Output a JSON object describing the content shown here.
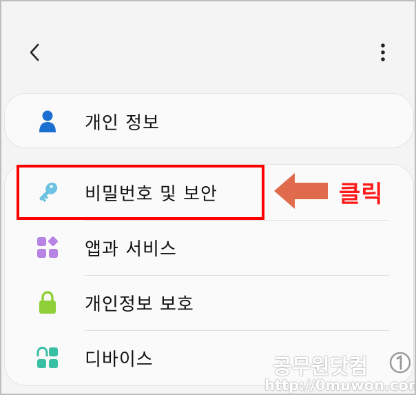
{
  "menu": {
    "items": [
      {
        "label": "개인 정보",
        "icon": "person-icon",
        "color": "#1a6fd1"
      },
      {
        "label": "비밀번호 및 보안",
        "icon": "key-icon",
        "color": "#6ec3e2"
      },
      {
        "label": "앱과 서비스",
        "icon": "apps-icon",
        "color": "#b784e6"
      },
      {
        "label": "개인정보 보호",
        "icon": "lock-icon",
        "color": "#8fcf38"
      },
      {
        "label": "디바이스",
        "icon": "devices-icon",
        "color": "#39bfa4"
      }
    ]
  },
  "annotation": {
    "click_label": "클릭",
    "highlight_color": "#ff0000",
    "arrow_color": "#e06a4c"
  },
  "watermark": {
    "name": "공무원닷컴",
    "url": "http://0muwon.com"
  },
  "colors": {
    "background": "#f4f4f4",
    "card": "#fafafa"
  }
}
